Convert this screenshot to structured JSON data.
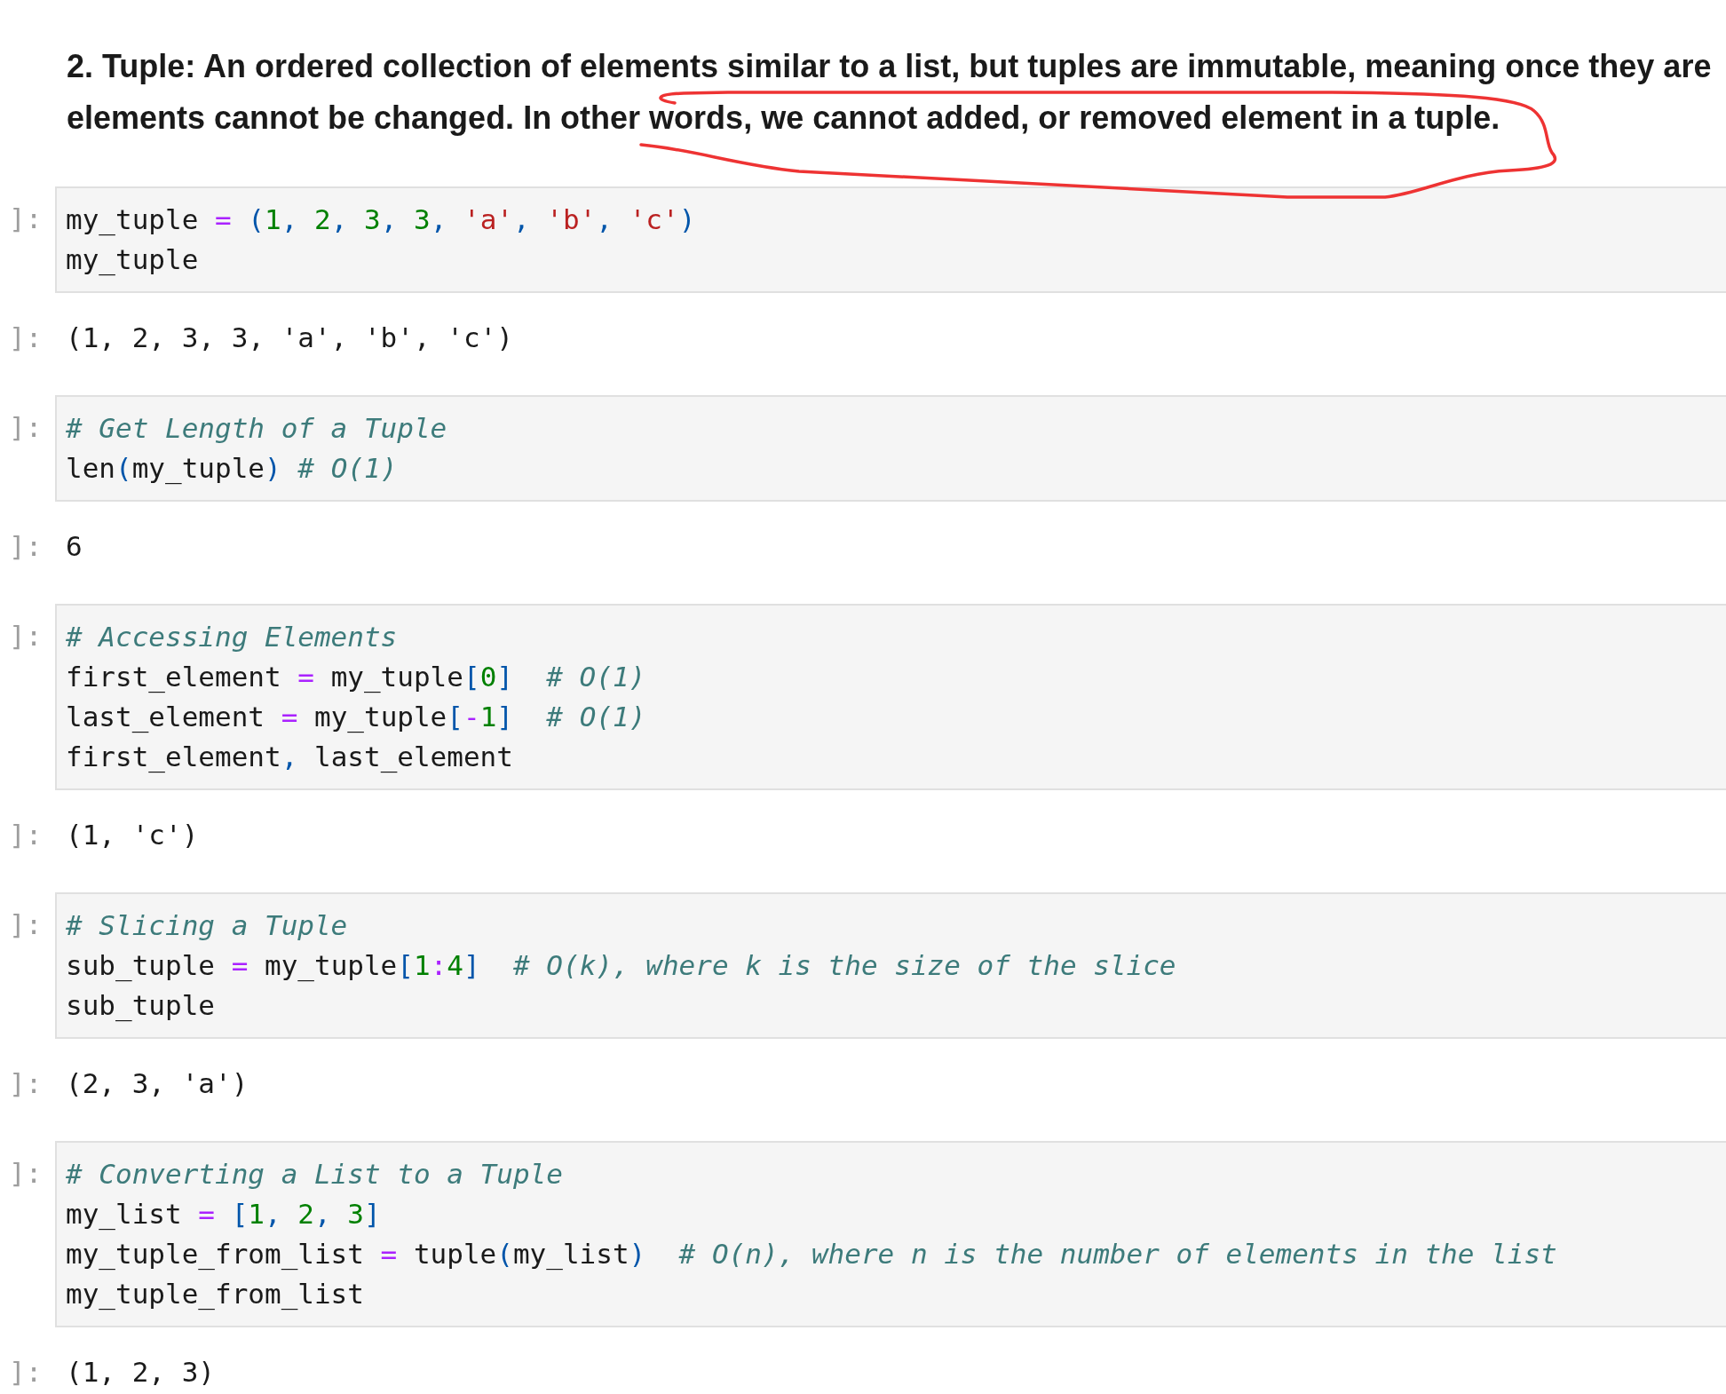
{
  "heading": {
    "lines": [
      "2. Tuple: An ordered collection of elements similar to a list, but tuples are immutable, meaning once they are",
      "elements cannot be changed. In other words, we cannot added, or removed element in a tuple."
    ]
  },
  "cells": [
    {
      "kind": "input",
      "prompt": "]:",
      "lines": [
        [
          {
            "kind": "name",
            "text": "my_tuple "
          },
          {
            "kind": "op",
            "text": "= "
          },
          {
            "kind": "paren",
            "text": "("
          },
          {
            "kind": "num",
            "text": "1"
          },
          {
            "kind": "paren",
            "text": ", "
          },
          {
            "kind": "num",
            "text": "2"
          },
          {
            "kind": "paren",
            "text": ", "
          },
          {
            "kind": "num",
            "text": "3"
          },
          {
            "kind": "paren",
            "text": ", "
          },
          {
            "kind": "num",
            "text": "3"
          },
          {
            "kind": "paren",
            "text": ", "
          },
          {
            "kind": "str",
            "text": "'a'"
          },
          {
            "kind": "paren",
            "text": ", "
          },
          {
            "kind": "str",
            "text": "'b'"
          },
          {
            "kind": "paren",
            "text": ", "
          },
          {
            "kind": "str",
            "text": "'c'"
          },
          {
            "kind": "paren",
            "text": ")"
          }
        ],
        [
          {
            "kind": "name",
            "text": "my_tuple"
          }
        ]
      ]
    },
    {
      "kind": "output",
      "prompt": "]:",
      "lines": [
        [
          {
            "kind": "name",
            "text": "(1, 2, 3, 3, 'a', 'b', 'c')"
          }
        ]
      ]
    },
    {
      "kind": "input",
      "prompt": "]:",
      "lines": [
        [
          {
            "kind": "comment",
            "text": "# Get Length of a Tuple"
          }
        ],
        [
          {
            "kind": "name",
            "text": "len"
          },
          {
            "kind": "paren",
            "text": "("
          },
          {
            "kind": "name",
            "text": "my_tuple"
          },
          {
            "kind": "paren",
            "text": ")"
          },
          {
            "kind": "comment",
            "text": " # O(1)"
          }
        ]
      ]
    },
    {
      "kind": "output",
      "prompt": "]:",
      "lines": [
        [
          {
            "kind": "name",
            "text": "6"
          }
        ]
      ]
    },
    {
      "kind": "input",
      "prompt": "]:",
      "lines": [
        [
          {
            "kind": "comment",
            "text": "# Accessing Elements"
          }
        ],
        [
          {
            "kind": "name",
            "text": "first_element "
          },
          {
            "kind": "op",
            "text": "="
          },
          {
            "kind": "name",
            "text": " my_tuple"
          },
          {
            "kind": "paren",
            "text": "["
          },
          {
            "kind": "num",
            "text": "0"
          },
          {
            "kind": "paren",
            "text": "]"
          },
          {
            "kind": "comment",
            "text": "  # O(1)"
          }
        ],
        [
          {
            "kind": "name",
            "text": "last_element "
          },
          {
            "kind": "op",
            "text": "="
          },
          {
            "kind": "name",
            "text": " my_tuple"
          },
          {
            "kind": "paren",
            "text": "["
          },
          {
            "kind": "op",
            "text": "-"
          },
          {
            "kind": "num",
            "text": "1"
          },
          {
            "kind": "paren",
            "text": "]"
          },
          {
            "kind": "comment",
            "text": "  # O(1)"
          }
        ],
        [
          {
            "kind": "name",
            "text": "first_element"
          },
          {
            "kind": "paren",
            "text": ","
          },
          {
            "kind": "name",
            "text": " last_element"
          }
        ]
      ]
    },
    {
      "kind": "output",
      "prompt": "]:",
      "lines": [
        [
          {
            "kind": "name",
            "text": "(1, 'c')"
          }
        ]
      ]
    },
    {
      "kind": "input",
      "prompt": "]:",
      "lines": [
        [
          {
            "kind": "comment",
            "text": "# Slicing a Tuple"
          }
        ],
        [
          {
            "kind": "name",
            "text": "sub_tuple "
          },
          {
            "kind": "op",
            "text": "="
          },
          {
            "kind": "name",
            "text": " my_tuple"
          },
          {
            "kind": "paren",
            "text": "["
          },
          {
            "kind": "num",
            "text": "1"
          },
          {
            "kind": "op",
            "text": ":"
          },
          {
            "kind": "num",
            "text": "4"
          },
          {
            "kind": "paren",
            "text": "]"
          },
          {
            "kind": "comment",
            "text": "  # O(k), where k is the size of the slice"
          }
        ],
        [
          {
            "kind": "name",
            "text": "sub_tuple"
          }
        ]
      ]
    },
    {
      "kind": "output",
      "prompt": "]:",
      "lines": [
        [
          {
            "kind": "name",
            "text": "(2, 3, 'a')"
          }
        ]
      ]
    },
    {
      "kind": "input",
      "prompt": "]:",
      "lines": [
        [
          {
            "kind": "comment",
            "text": "# Converting a List to a Tuple"
          }
        ],
        [
          {
            "kind": "name",
            "text": "my_list "
          },
          {
            "kind": "op",
            "text": "= "
          },
          {
            "kind": "paren",
            "text": "["
          },
          {
            "kind": "num",
            "text": "1"
          },
          {
            "kind": "paren",
            "text": ", "
          },
          {
            "kind": "num",
            "text": "2"
          },
          {
            "kind": "paren",
            "text": ", "
          },
          {
            "kind": "num",
            "text": "3"
          },
          {
            "kind": "paren",
            "text": "]"
          }
        ],
        [
          {
            "kind": "name",
            "text": "my_tuple_from_list "
          },
          {
            "kind": "op",
            "text": "="
          },
          {
            "kind": "name",
            "text": " tuple"
          },
          {
            "kind": "paren",
            "text": "("
          },
          {
            "kind": "name",
            "text": "my_list"
          },
          {
            "kind": "paren",
            "text": ")"
          },
          {
            "kind": "comment",
            "text": "  # O(n), where n is the number of elements in the list"
          }
        ],
        [
          {
            "kind": "name",
            "text": "my_tuple_from_list"
          }
        ]
      ]
    },
    {
      "kind": "output",
      "prompt": "]:",
      "lines": [
        [
          {
            "kind": "name",
            "text": "(1, 2, 3)"
          }
        ]
      ]
    }
  ]
}
